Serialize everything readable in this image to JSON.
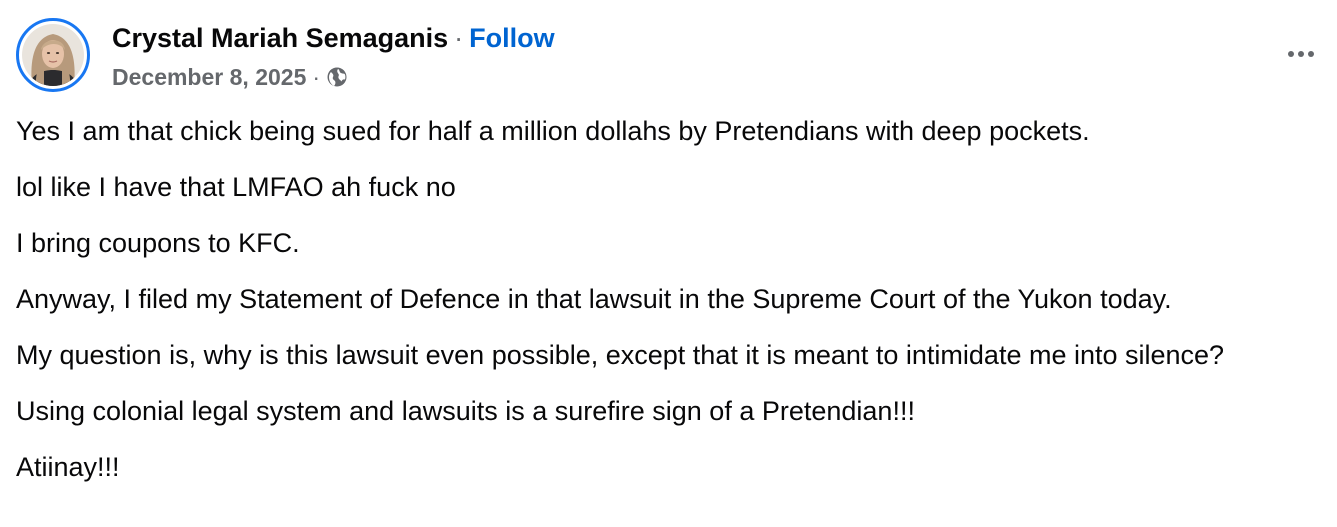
{
  "post": {
    "author": "Crystal Mariah Semaganis",
    "separator": "·",
    "follow_label": "Follow",
    "date": "December 8, 2025",
    "meta_separator": "·",
    "audience_icon": "globe-icon",
    "more_icon": "more-horizontal-icon",
    "paragraphs": [
      "Yes I am that chick being sued for half a million dollahs by Pretendians with deep pockets.",
      "lol like I have that LMFAO ah fuck no",
      "I bring coupons to KFC.",
      "Anyway, I filed my Statement of Defence in that lawsuit in the Supreme Court of the Yukon today.",
      "My question is, why is this lawsuit even possible, except that it is meant to intimidate me into silence?",
      "Using colonial legal system and lawsuits is a surefire sign of a Pretendian!!!",
      "Atiinay!!!"
    ]
  },
  "colors": {
    "story_ring": "#1877f2",
    "follow_link": "#0064d1",
    "secondary_text": "#65686c",
    "primary_text": "#080809"
  }
}
